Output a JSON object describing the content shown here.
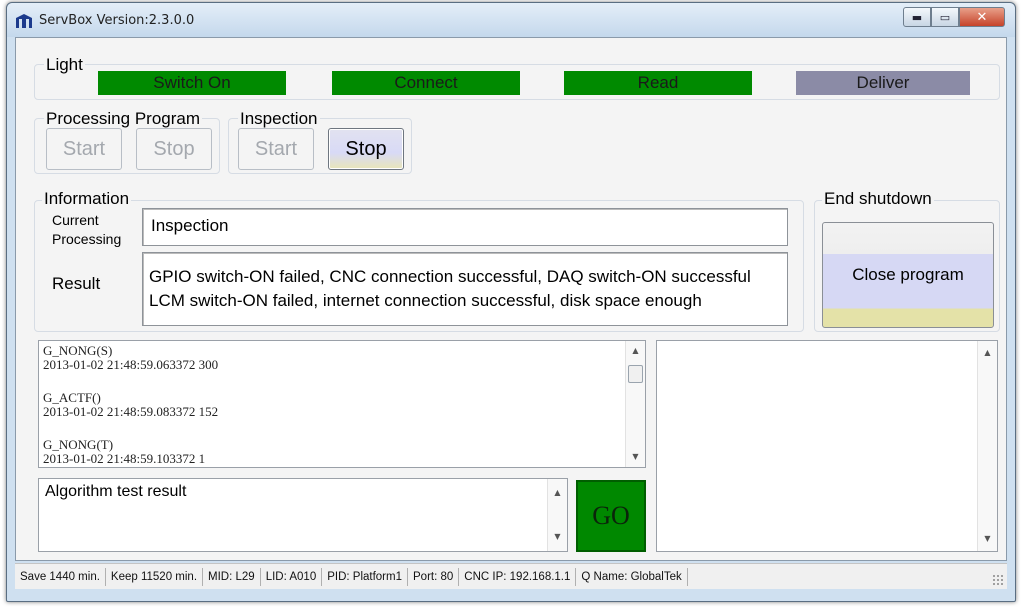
{
  "window": {
    "title": "ServBox Version:2.3.0.0"
  },
  "window_controls": {
    "minimize": "▬",
    "maximize": "▭",
    "close": "✕"
  },
  "light": {
    "label": "Light",
    "items": [
      {
        "label": "Switch On",
        "color": "#008a00"
      },
      {
        "label": "Connect",
        "color": "#008a00"
      },
      {
        "label": "Read",
        "color": "#008a00"
      },
      {
        "label": "Deliver",
        "color": "#8b8ba6"
      }
    ]
  },
  "processing_program": {
    "label": "Processing Program",
    "start": "Start",
    "stop": "Stop"
  },
  "inspection": {
    "label": "Inspection",
    "start": "Start",
    "stop": "Stop"
  },
  "information": {
    "label": "Information",
    "current_label_1": "Current",
    "current_label_2": "Processing",
    "current_value": "Inspection",
    "result_label": "Result",
    "result_line_1": "GPIO switch-ON failed, CNC connection successful, DAQ switch-ON successful",
    "result_line_2": "LCM switch-ON failed, internet connection successful, disk space enough"
  },
  "end_shutdown": {
    "label": "End shutdown",
    "button": "Close program"
  },
  "log": {
    "entries": [
      {
        "name": "G_NONG(S)",
        "value": "2013-01-02 21:48:59.063372 300"
      },
      {
        "name": "G_ACTF()",
        "value": "2013-01-02 21:48:59.083372 152"
      },
      {
        "name": "G_NONG(T)",
        "value": "2013-01-02 21:48:59.103372 1"
      }
    ]
  },
  "algorithm": {
    "label": "Algorithm test result",
    "go": "GO"
  },
  "status_bar": [
    "Save 1440 min.",
    "Keep 11520 min.",
    "MID: L29",
    "LID: A010",
    "PID: Platform1",
    "Port: 80",
    "CNC IP: 192.168.1.1",
    "Q Name: GlobalTek"
  ],
  "colors": {
    "light_on": "#008a00",
    "light_off": "#8b8ba6",
    "go_button": "#008800"
  }
}
